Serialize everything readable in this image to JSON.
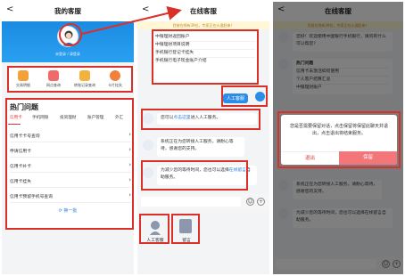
{
  "panel1": {
    "title": "我的客服",
    "back": "<",
    "login": "未登录 / 请登录",
    "quick": [
      {
        "label": "交易明细",
        "icon": "transaction-icon",
        "color": "#f4a13a"
      },
      {
        "label": "网点查询",
        "icon": "branch-icon",
        "color": "#f06a6a"
      },
      {
        "label": "转账记录查询",
        "icon": "transfer-record-icon",
        "color": "#f3b23b"
      },
      {
        "label": "卡片挂失",
        "icon": "card-loss-icon",
        "color": "#f0803a"
      }
    ],
    "hot_title": "热门问题",
    "tabs": [
      "信用卡",
      "手机网银",
      "投资理财",
      "账户管理",
      "外汇"
    ],
    "questions": [
      "信用卡卡号查询",
      "申请信用卡",
      "信用卡补卡",
      "信用卡挂失",
      "信用卡预留手机号查询"
    ],
    "refresh": "换一批"
  },
  "panel2": {
    "title": "在线客服",
    "back": "<",
    "notice": "目前在线有39位，专家正在火速赶来！",
    "menu": [
      "中银理财返回账户",
      "中银理财项目说明",
      "手机银行登记卡挂失",
      "手机银行电子现金账户介绍"
    ],
    "user_msg": "人工客服",
    "reply_prefix": "您可以",
    "reply_link": "点击这里",
    "reply_suffix": "进入人工服务。",
    "system_msg": "系统正在为您转接人工服务，请耐心等待，感谢您的支持。",
    "wait_msg_1": "为减少您的等待时间，您也可以选择",
    "wait_link": "在线留言",
    "wait_msg_2": "自助服务。",
    "btn_human": "人工客服",
    "btn_message": "留言"
  },
  "panel3": {
    "title": "在线客服",
    "back": "<",
    "notice": "目前在线有39位，专家正在火速赶来！",
    "greeting": "您好！欢迎使用中国银行手机银行，请问有什么可以帮您？",
    "menu_title": "热门问题",
    "menu": [
      "信用卡未激活如何使用",
      "个人客户结算汇总",
      "中银理财账户"
    ],
    "dialog_msg": "您是否需要保留对话，点击保留将保留此聊天并退出，点击退出将结束服务。",
    "btn_exit": "退出",
    "btn_keep": "保留",
    "system_msg": "系统正在为您转接人工服务，请耐心等待，感谢您的支持。",
    "wait_msg": "为减少您的等待时间，您也可以选择在线留言自助服务。"
  }
}
